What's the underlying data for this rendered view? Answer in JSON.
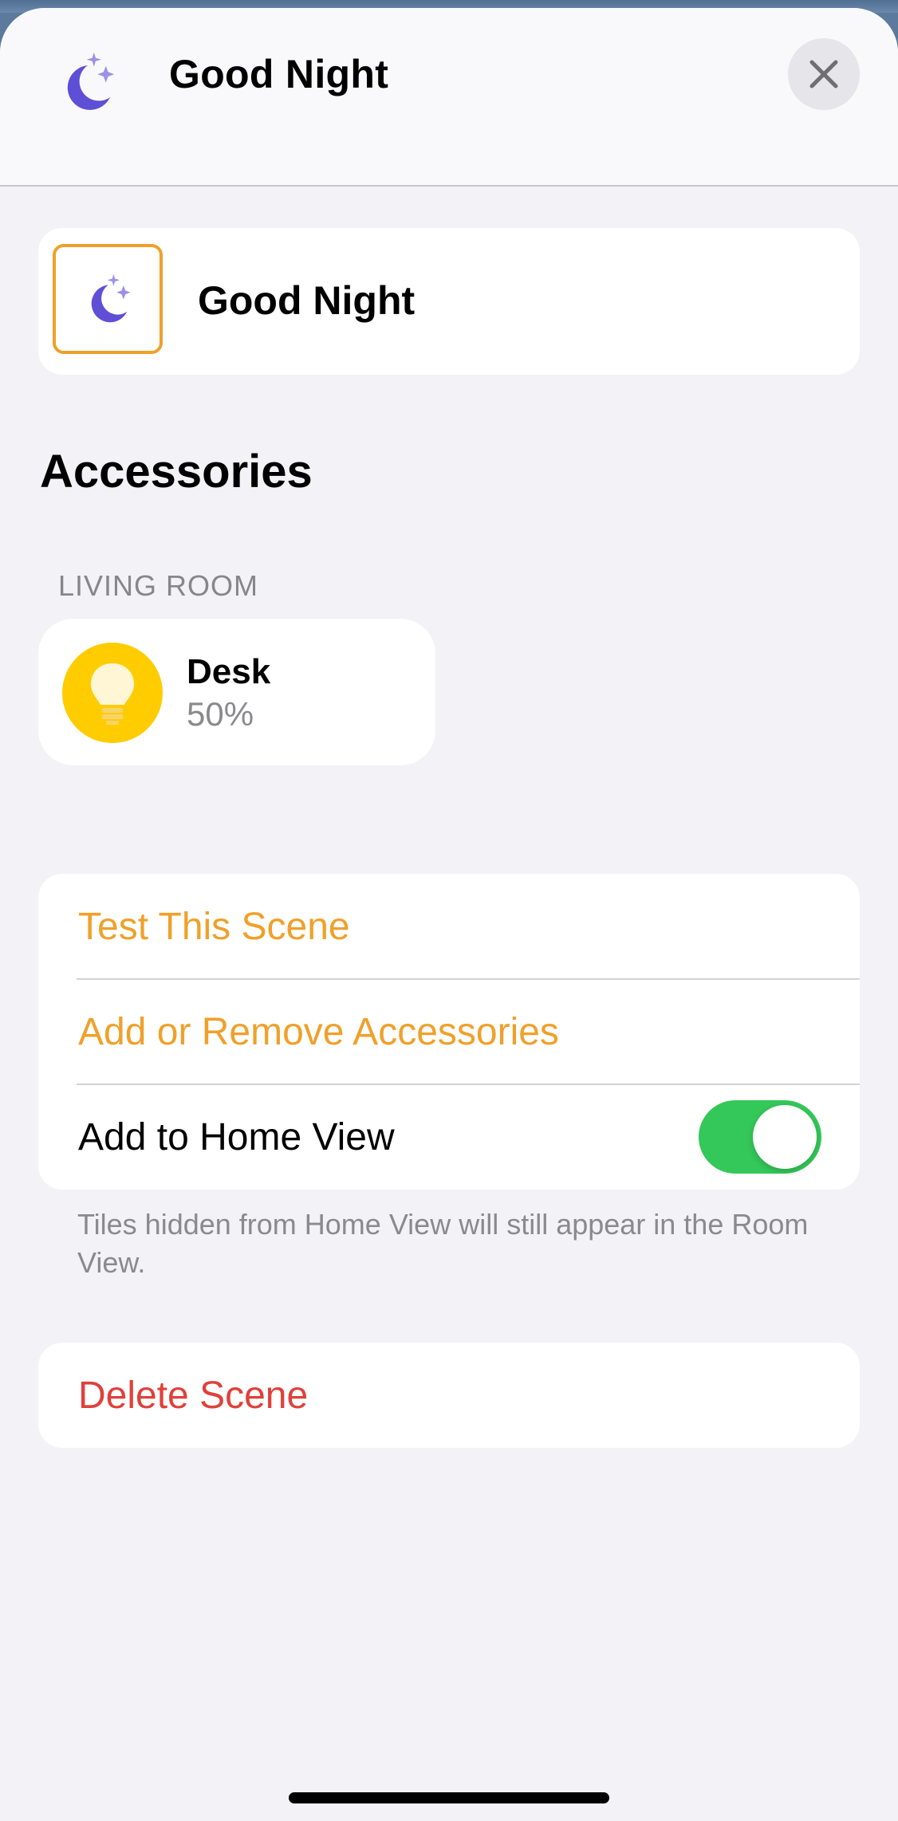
{
  "header": {
    "title": "Good Night",
    "icon": "moon-stars-icon",
    "close_icon": "close-icon"
  },
  "scene": {
    "name": "Good Night",
    "icon": "moon-stars-icon"
  },
  "accessories": {
    "section_title": "Accessories",
    "rooms": [
      {
        "label": "LIVING ROOM",
        "items": [
          {
            "name": "Desk",
            "status": "50%",
            "icon": "lightbulb-icon"
          }
        ]
      }
    ]
  },
  "actions": {
    "test_scene": "Test This Scene",
    "add_remove": "Add or Remove Accessories",
    "home_view": "Add to Home View",
    "home_view_enabled": true,
    "footnote": "Tiles hidden from Home View will still appear in the Room View."
  },
  "delete": {
    "label": "Delete Scene"
  },
  "colors": {
    "accent": "#f0a02a",
    "destructive": "#e0403a",
    "toggle_on": "#34c759",
    "moon": "#5e4fd6",
    "bulb": "#ffcc00"
  }
}
